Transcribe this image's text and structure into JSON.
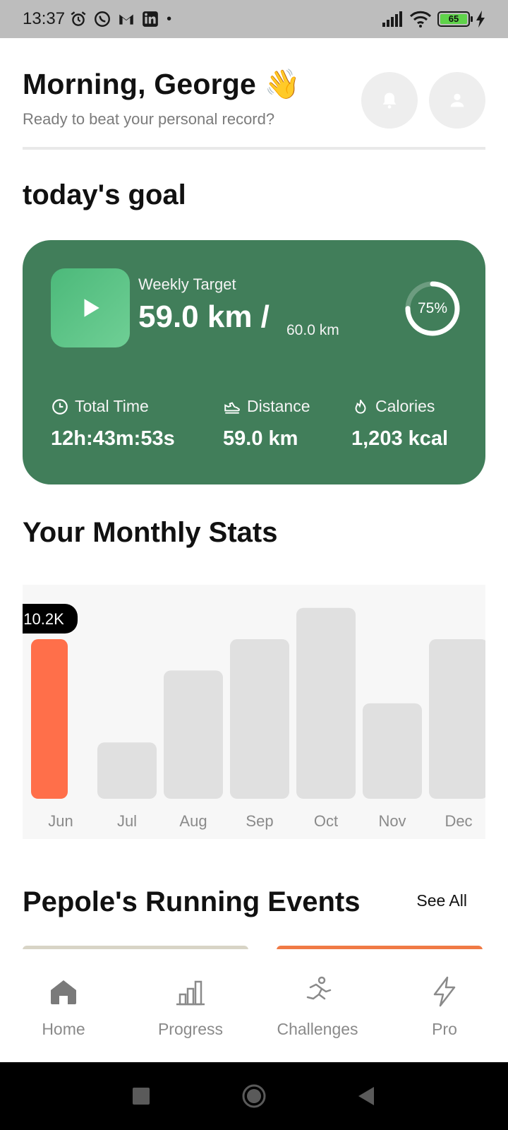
{
  "status_bar": {
    "time": "13:37",
    "battery": "65"
  },
  "header": {
    "greeting": "Morning, George 👋",
    "subtitle": "Ready to beat your personal record?"
  },
  "goal_section": {
    "title": "today's goal"
  },
  "goal_card": {
    "weekly_label": "Weekly Target",
    "current": "59.0 km /",
    "target": "60.0 km",
    "progress_label": "75%",
    "progress_fraction": 0.75,
    "stats": [
      {
        "label": "Total Time",
        "value": "12h:43m:53s",
        "icon": "clock-icon"
      },
      {
        "label": "Distance",
        "value": "59.0 km",
        "icon": "shoe-icon"
      },
      {
        "label": "Calories",
        "value": "1,203 kcal",
        "icon": "flame-icon"
      }
    ]
  },
  "stats_section": {
    "title": "Your Monthly Stats"
  },
  "chart_data": {
    "type": "bar",
    "categories": [
      "Jun",
      "Jul",
      "Aug",
      "Sep",
      "Oct",
      "Nov",
      "Dec"
    ],
    "values": [
      10.2,
      3.6,
      8.2,
      10.2,
      12.2,
      6.1,
      10.2
    ],
    "highlight_index": 0,
    "highlight_label": "10.2K",
    "highlight_color": "#ff6f4a",
    "bar_color": "#e0e0e0",
    "ylim": [
      0,
      13
    ]
  },
  "events_section": {
    "title": "Pepole's Running Events",
    "see_all": "See All"
  },
  "bottom_nav": [
    {
      "label": "Home",
      "icon": "home-icon",
      "active": true
    },
    {
      "label": "Progress",
      "icon": "bar-chart-icon",
      "active": false
    },
    {
      "label": "Challenges",
      "icon": "runner-icon",
      "active": false
    },
    {
      "label": "Pro",
      "icon": "lightning-icon",
      "active": false
    }
  ],
  "colors": {
    "card": "#417e5a",
    "accent": "#ff6f4a"
  }
}
